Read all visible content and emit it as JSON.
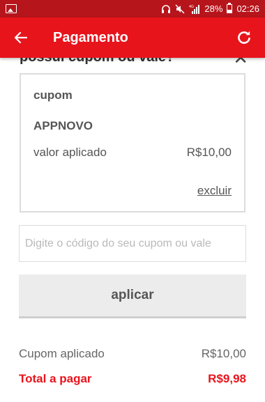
{
  "status_bar": {
    "battery": "28%",
    "time": "02:26",
    "network": "4G",
    "icons": [
      "image-icon",
      "headphones-icon",
      "mute-icon",
      "signal-icon",
      "battery-icon"
    ]
  },
  "app_bar": {
    "title": "Pagamento",
    "back_icon": "arrow-left-icon",
    "refresh_icon": "refresh-icon",
    "color": "#e8141c"
  },
  "coupon_section": {
    "header": "possui cupom ou vale?",
    "close_icon": "close-icon"
  },
  "coupon_card": {
    "label": "cupom",
    "code": "APPNOVO",
    "applied_label": "valor aplicado",
    "applied_value": "R$10,00",
    "remove_link": "excluir"
  },
  "code_input": {
    "placeholder": "Digite o código do seu cupom ou vale",
    "value": ""
  },
  "apply_button": {
    "label": "aplicar"
  },
  "summary": {
    "coupon_label": "Cupom aplicado",
    "coupon_value": "R$10,00",
    "total_label": "Total a pagar",
    "total_value": "R$9,98",
    "total_color": "#e8141c"
  }
}
